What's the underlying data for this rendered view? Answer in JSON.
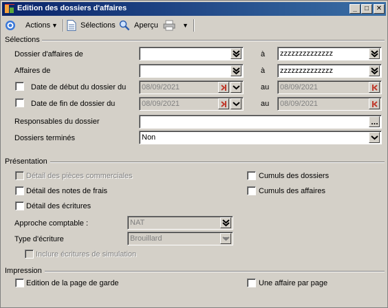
{
  "window": {
    "title": "Edition des dossiers d'affaires"
  },
  "toolbar": {
    "actions_label": "Actions",
    "selections_label": "Sélections",
    "preview_label": "Aperçu"
  },
  "sections": {
    "selections": "Sélections",
    "presentation": "Présentation",
    "impression": "Impression"
  },
  "selections": {
    "dossier_from_label": "Dossier d'affaires de",
    "dossier_from_value": "",
    "dossier_to_label": "à",
    "dossier_to_value": "zzzzzzzzzzzzzz",
    "affaires_from_label": "Affaires de",
    "affaires_from_value": "",
    "affaires_to_label": "à",
    "affaires_to_value": "zzzzzzzzzzzzzz",
    "start_date_label": "Date de début du dossier du",
    "start_date_from": "08/09/2021",
    "start_date_to_label": "au",
    "start_date_to": "08/09/2021",
    "end_date_label": "Date de fin de dossier du",
    "end_date_from": "08/09/2021",
    "end_date_to_label": "au",
    "end_date_to": "08/09/2021",
    "responsables_label": "Responsables du dossier",
    "responsables_value": "",
    "termines_label": "Dossiers terminés",
    "termines_value": "Non"
  },
  "presentation": {
    "detail_pieces_label": "Détail des pièces commerciales",
    "detail_notes_label": "Détail des notes de frais",
    "detail_ecritures_label": "Détail des écritures",
    "cumuls_dossiers_label": "Cumuls des dossiers",
    "cumuls_affaires_label": "Cumuls des affaires",
    "approche_label": "Approche comptable :",
    "approche_value": "NAT",
    "type_ecriture_label": "Type d'écriture",
    "type_ecriture_value": "Brouillard",
    "inclure_simulation_label": "Inclure écritures de simulation"
  },
  "impression": {
    "page_garde_label": "Edition de la page de garde",
    "une_affaire_label": "Une affaire par page"
  },
  "icons": {
    "app": "app-icon",
    "actions": "target-icon",
    "selections": "document-icon",
    "preview": "magnifier-icon",
    "print": "printer-icon"
  }
}
